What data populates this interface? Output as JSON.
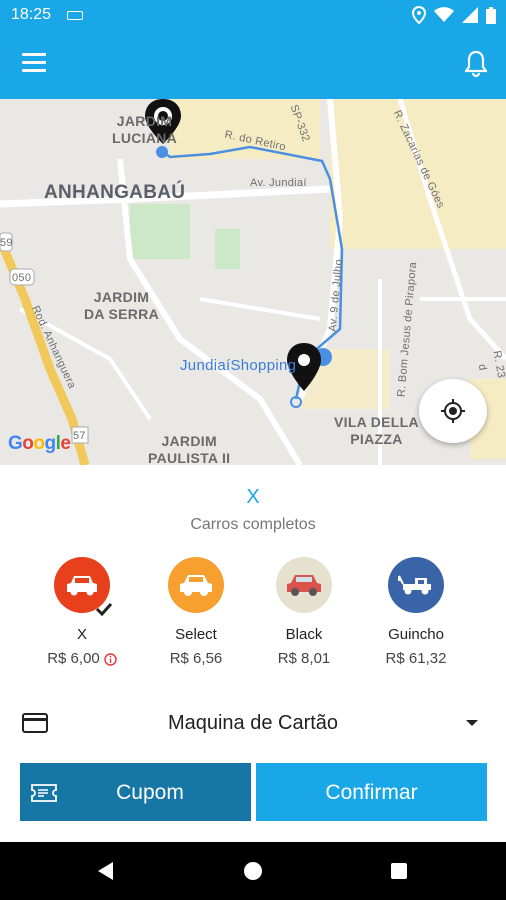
{
  "status_bar": {
    "time": "18:25"
  },
  "map": {
    "labels": {
      "jardim_luciana": "JARDIM\nLUCIANA",
      "anhangabau": "ANHANGABAÚ",
      "jardim_da_serra": "JARDIM\nDA SERRA",
      "jardim_paulista": "JARDIM\nPAULISTA II",
      "vila_della_piazza": "VILA DELLA\nPIAZZA",
      "jundiai_shopping": "JundiaíShopping",
      "r_do_retiro": "R. do Retiro",
      "av_jundiai": "Av. Jundiaí",
      "sp_332": "SP-332",
      "r_zacarias": "R. Zacarias de Góes",
      "av_9_de_julho": "Av. 9 de Julho",
      "rod_anhanguera": "Rod. Anhanguera",
      "r_bom_jesus": "R. Bom Jesus de Pirapora",
      "r_23": "R. 23 d",
      "route_050": "050",
      "route_59": "59",
      "route_57": "57"
    },
    "google_logo": [
      "G",
      "o",
      "o",
      "g",
      "l",
      "e"
    ]
  },
  "category": {
    "title": "X",
    "subtitle": "Carros completos"
  },
  "options": [
    {
      "name": "X",
      "price": "R$ 6,00",
      "color": "#e8401c",
      "icon": "car-icon",
      "selected": true
    },
    {
      "name": "Select",
      "price": "R$ 6,56",
      "color": "#f7a030",
      "icon": "car-icon",
      "selected": false
    },
    {
      "name": "Black",
      "price": "R$ 8,01",
      "color": "#e6e0cf",
      "icon": "car-icon",
      "selected": false
    },
    {
      "name": "Guincho",
      "price": "R$ 61,32",
      "color": "#3a64a8",
      "icon": "tow-truck-icon",
      "selected": false
    }
  ],
  "payment": {
    "method": "Maquina de Cartão"
  },
  "buttons": {
    "coupon": "Cupom",
    "confirm": "Confirmar"
  },
  "colors": {
    "primary": "#1aa7e8",
    "primary_dark": "#1677a6"
  }
}
